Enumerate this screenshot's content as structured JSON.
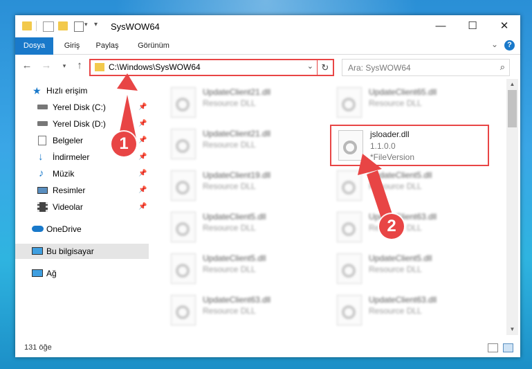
{
  "window": {
    "title": "SysWOW64",
    "controls": {
      "minimize": "—",
      "maximize": "☐",
      "close": "✕"
    }
  },
  "ribbon": {
    "tabs": [
      "Dosya",
      "Giriş",
      "Paylaş",
      "Görünüm"
    ],
    "help": "?"
  },
  "navbar": {
    "address": "C:\\Windows\\SysWOW64",
    "search_placeholder": "Ara: SysWOW64"
  },
  "navpane": {
    "items": [
      {
        "label": "Hızlı erişim",
        "icon": "star-icon"
      },
      {
        "label": "Yerel Disk (C:)",
        "icon": "drive-icon",
        "pinned": true
      },
      {
        "label": "Yerel Disk (D:)",
        "icon": "drive-icon",
        "pinned": true
      },
      {
        "label": "Belgeler",
        "icon": "documents-icon",
        "pinned": true
      },
      {
        "label": "İndirmeler",
        "icon": "download-icon",
        "pinned": true
      },
      {
        "label": "Müzik",
        "icon": "music-icon",
        "pinned": true
      },
      {
        "label": "Resimler",
        "icon": "pictures-icon",
        "pinned": true
      },
      {
        "label": "Videolar",
        "icon": "videos-icon",
        "pinned": true
      },
      {
        "label": "OneDrive",
        "icon": "cloud-icon"
      },
      {
        "label": "Bu bilgisayar",
        "icon": "computer-icon",
        "selected": true
      },
      {
        "label": "Ağ",
        "icon": "network-icon"
      }
    ]
  },
  "files": [
    {
      "name": "UpdateClient21.dll",
      "type": "Resource DLL"
    },
    {
      "name": "UpdateClient65.dll",
      "type": "Resource DLL"
    },
    {
      "name": "UpdateClient21.dll",
      "type": "Resource DLL"
    },
    {
      "name": "jsloader.dll",
      "type": "1.1.0.0",
      "version": "*FileVersion"
    },
    {
      "name": "UpdateClient19.dll",
      "type": "Resource DLL"
    },
    {
      "name": "UpdateClient5.dll",
      "type": "Resource DLL"
    },
    {
      "name": "UpdateClient5.dll",
      "type": "Resource DLL"
    },
    {
      "name": "UpdateClient63.dll",
      "type": "Resource DLL"
    },
    {
      "name": "UpdateClient5.dll",
      "type": "Resource DLL"
    },
    {
      "name": "UpdateClient5.dll",
      "type": "Resource DLL"
    },
    {
      "name": "UpdateClient63.dll",
      "type": "Resource DLL"
    },
    {
      "name": "UpdateClient63.dll",
      "type": "Resource DLL"
    }
  ],
  "status": {
    "count": "131 öğe"
  },
  "annotations": {
    "step1": "1",
    "step2": "2",
    "color": "#e84545"
  },
  "colors": {
    "accent": "#1979ca",
    "highlight": "#e84545",
    "folder": "#f2c94c"
  }
}
